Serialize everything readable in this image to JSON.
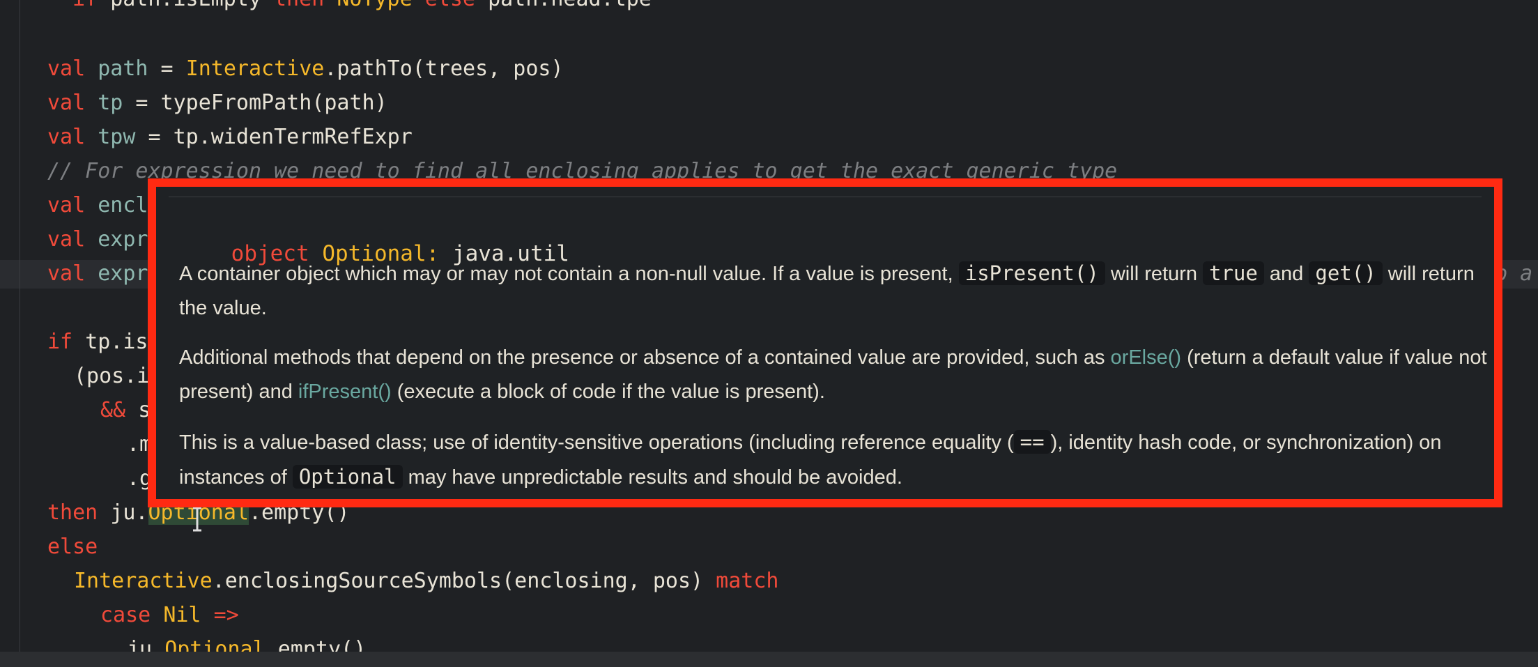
{
  "editor": {
    "lines": [
      {
        "segments": [
          {
            "t": "if ",
            "c": "kw"
          },
          {
            "t": "path.isEmpty ",
            "c": ""
          },
          {
            "t": "then ",
            "c": "kw"
          },
          {
            "t": "NoType ",
            "c": "ty"
          },
          {
            "t": "else ",
            "c": "kw"
          },
          {
            "t": "path.head.tpe",
            "c": ""
          }
        ]
      },
      {
        "segments": [
          {
            "t": "val ",
            "c": "kw"
          },
          {
            "t": "path",
            "c": "vr"
          },
          {
            "t": " = ",
            "c": ""
          },
          {
            "t": "Interactive",
            "c": "ty"
          },
          {
            "t": ".pathTo(trees, pos)",
            "c": ""
          }
        ]
      },
      {
        "segments": [
          {
            "t": "val ",
            "c": "kw"
          },
          {
            "t": "tp",
            "c": "vr"
          },
          {
            "t": " = typeFromPath(path)",
            "c": ""
          }
        ]
      },
      {
        "segments": [
          {
            "t": "val ",
            "c": "kw"
          },
          {
            "t": "tpw",
            "c": "vr"
          },
          {
            "t": " = tp.widenTermRefExpr",
            "c": ""
          }
        ]
      },
      {
        "segments": [
          {
            "t": "// For expression we need to find all enclosing applies to get the exact generic type",
            "c": "cm"
          }
        ]
      },
      {
        "segments": [
          {
            "t": "val ",
            "c": "kw"
          },
          {
            "t": "encl",
            "c": "vr"
          }
        ]
      },
      {
        "segments": [
          {
            "t": "val ",
            "c": "kw"
          },
          {
            "t": "expr",
            "c": "vr"
          }
        ]
      },
      {
        "segments": [
          {
            "t": "val ",
            "c": "kw"
          },
          {
            "t": "expr",
            "c": "vr"
          }
        ]
      },
      {
        "segments": [
          {
            "t": "p a s",
            "c": "cm"
          }
        ]
      },
      {
        "segments": [
          {
            "t": "if ",
            "c": "kw"
          },
          {
            "t": "tp.is",
            "c": ""
          }
        ]
      },
      {
        "segments": [
          {
            "t": "(pos.i",
            "c": ""
          }
        ]
      },
      {
        "segments": [
          {
            "t": "&& ",
            "c": "kw"
          },
          {
            "t": "s",
            "c": ""
          }
        ]
      },
      {
        "segments": [
          {
            "t": ".m",
            "c": ""
          }
        ]
      },
      {
        "segments": [
          {
            "t": ".g",
            "c": ""
          }
        ]
      },
      {
        "segments": [
          {
            "t": "then ",
            "c": "kw"
          },
          {
            "t": "ju.",
            "c": ""
          },
          {
            "t": "Optional",
            "c": "ty hl"
          },
          {
            "t": ".empty()",
            "c": ""
          }
        ]
      },
      {
        "segments": [
          {
            "t": "else",
            "c": "kw"
          }
        ]
      },
      {
        "segments": [
          {
            "t": "Interactive",
            "c": "ty"
          },
          {
            "t": ".enclosingSourceSymbols(enclosing, pos) ",
            "c": ""
          },
          {
            "t": "match",
            "c": "kw"
          }
        ]
      },
      {
        "segments": [
          {
            "t": "case ",
            "c": "kw"
          },
          {
            "t": "Nil ",
            "c": "ty"
          },
          {
            "t": "=>",
            "c": "kw"
          }
        ]
      },
      {
        "segments": [
          {
            "t": "ju.",
            "c": ""
          },
          {
            "t": "Optional",
            "c": "ty"
          },
          {
            "t": ".empty()",
            "c": ""
          }
        ]
      }
    ]
  },
  "tooltip": {
    "sig_keyword": "object",
    "sig_name": "Optional:",
    "sig_package": "java.util",
    "p1_text_a": "A container object which may or may not contain a non-null value. If a value is present,",
    "p1_code_a": "isPresent()",
    "p1_text_b": "will return",
    "p1_code_b": "true",
    "p1_text_c": "and",
    "p1_code_c": "get()",
    "p1_text_d": "will return the value.",
    "p2_text_a": "Additional methods that depend on the presence or absence of a contained value are provided, such as",
    "p2_link_a": "orElse()",
    "p2_text_b": "(return a default value if value not present) and",
    "p2_link_b": "ifPresent()",
    "p2_text_c": "(execute a block of code if the value is present).",
    "p3_text_a": "This is a value-based class; use of identity-sensitive operations (including reference equality (",
    "p3_code_a": "==",
    "p3_text_b": "), identity hash code, or synchronization) on instances of",
    "p3_code_b": "Optional",
    "p3_text_c": "may have unpredictable results and should be avoided."
  },
  "colors": {
    "background": "#1f2124",
    "keyword": "#f04a3a",
    "type": "#f5b82a",
    "highlight_border": "#ff2a12",
    "link": "#6aa8a0"
  }
}
